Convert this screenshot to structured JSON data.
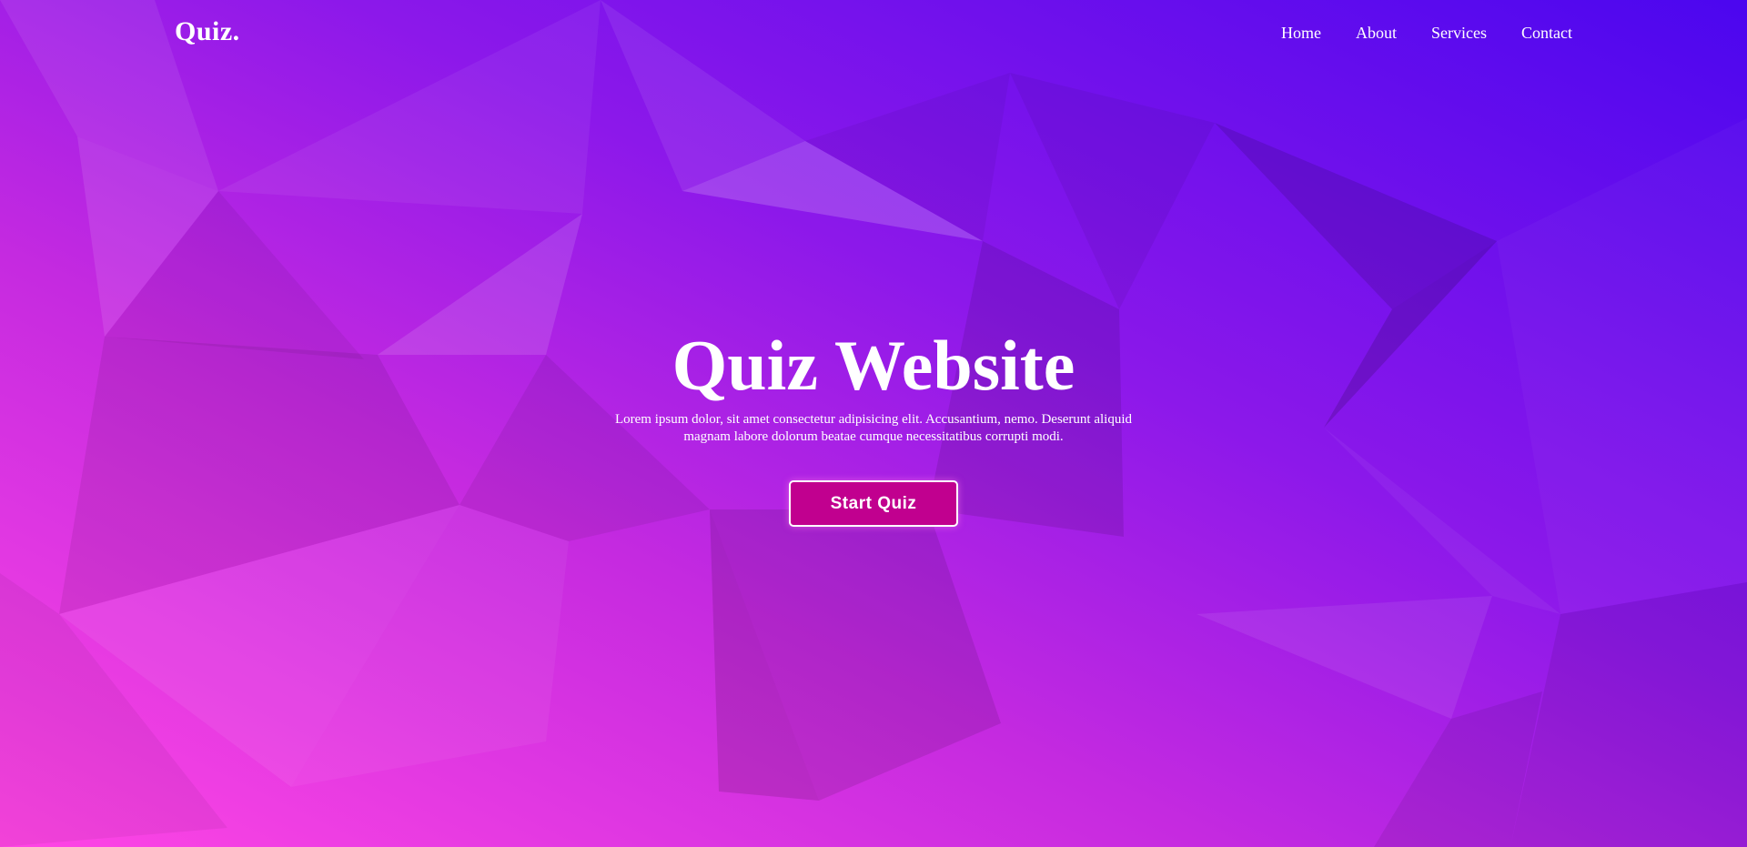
{
  "header": {
    "logo": "Quiz.",
    "nav": [
      {
        "label": "Home"
      },
      {
        "label": "About"
      },
      {
        "label": "Services"
      },
      {
        "label": "Contact"
      }
    ]
  },
  "hero": {
    "title": "Quiz Website",
    "description": "Lorem ipsum dolor, sit amet consectetur adipisicing elit. Accusantium, nemo. Deserunt aliquid magnam labore dolorum beatae cumque necessitatibus corrupti modi.",
    "cta_label": "Start Quiz"
  },
  "colors": {
    "gradient_start": "#f04bf5",
    "gradient_mid": "#8a1ae8",
    "gradient_end": "#4a08ee",
    "button": "#c1008f"
  }
}
